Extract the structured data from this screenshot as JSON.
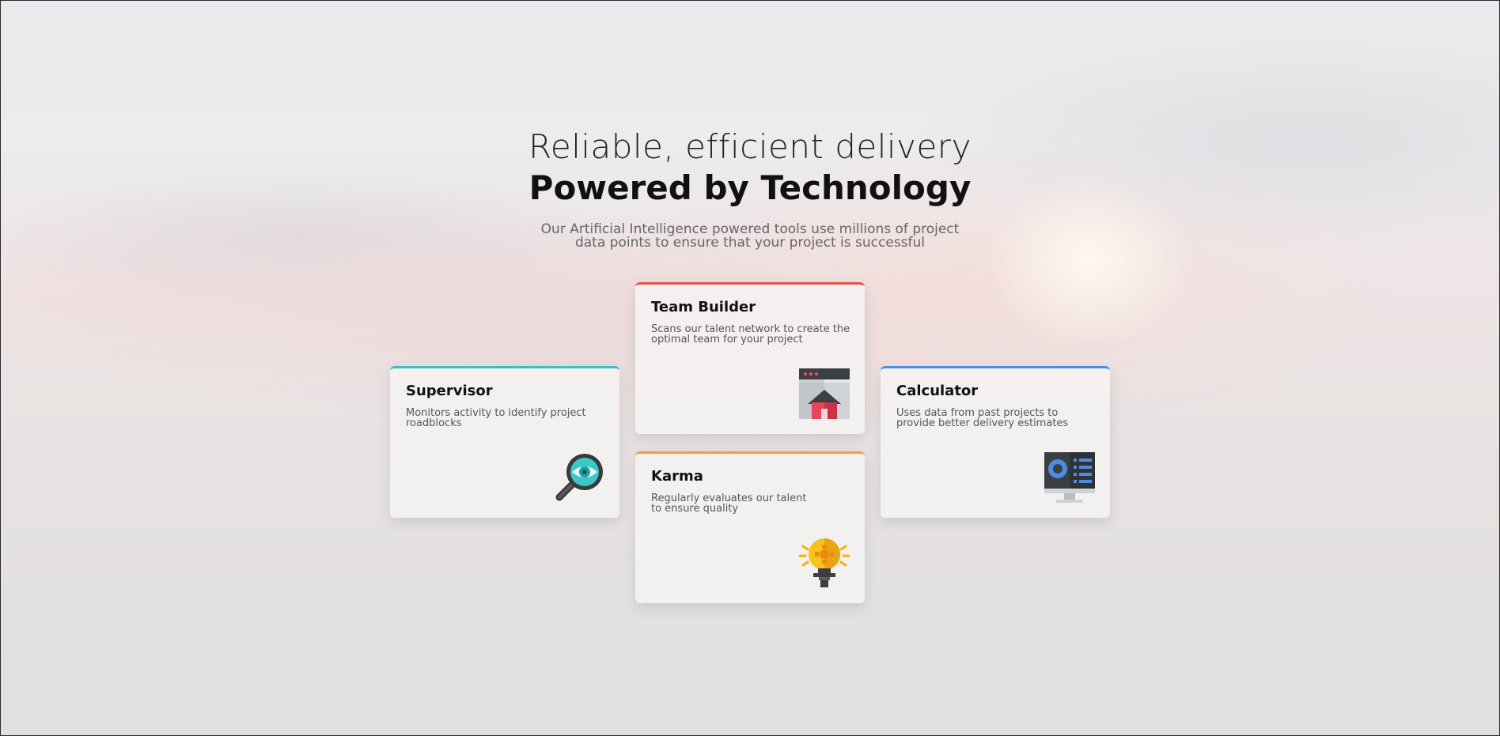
{
  "hero": {
    "line1": "Reliable, efficient delivery",
    "line2": "Powered by Technology",
    "description": "Our Artificial Intelligence powered tools use millions of project data points to ensure that your project is successful"
  },
  "cards": {
    "supervisor": {
      "title": "Supervisor",
      "description": "Monitors activity to identify project roadblocks",
      "accent": "#3bbfc4",
      "icon": "magnifier-eye-icon"
    },
    "team_builder": {
      "title": "Team Builder",
      "description": "Scans our talent network to create the optimal team for your project",
      "accent": "#e0524c",
      "icon": "browser-home-icon"
    },
    "calculator": {
      "title": "Calculator",
      "description": "Uses data from past projects to provide better delivery estimates",
      "accent": "#4a8de3",
      "icon": "monitor-chart-icon"
    },
    "karma": {
      "title": "Karma",
      "description": "Regularly evaluates our talent to ensure quality",
      "accent": "#f0a03c",
      "icon": "lightbulb-icon"
    }
  }
}
